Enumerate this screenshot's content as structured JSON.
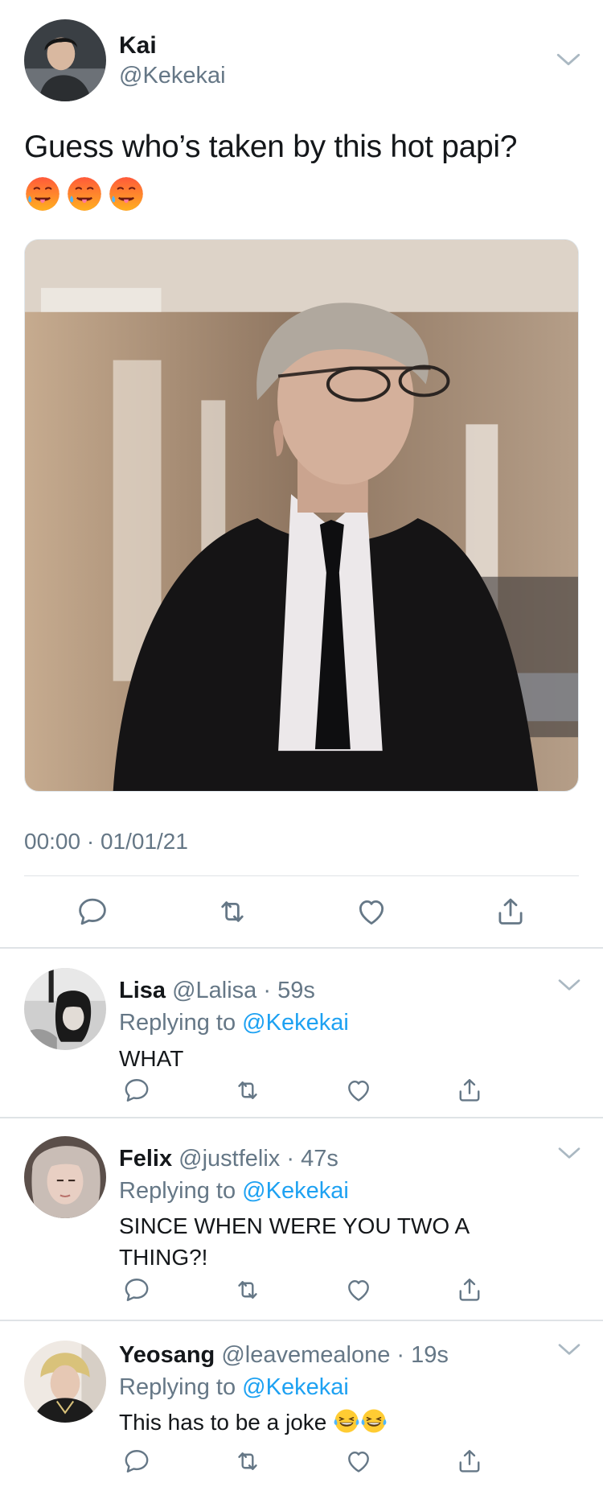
{
  "main_tweet": {
    "author_name": "Kai",
    "author_handle": "@Kekekai",
    "text": "Guess who’s taken by this hot papi?",
    "emojis": [
      "hot-face-emoji",
      "hot-face-emoji",
      "hot-face-emoji"
    ],
    "timestamp": "00:00 · 01/01/21",
    "actions": [
      "reply-icon",
      "retweet-icon",
      "like-icon",
      "share-icon"
    ]
  },
  "replies": [
    {
      "name": "Lisa",
      "handle": "@Lalisa",
      "time": "59s",
      "replying_prefix": "Replying to",
      "replying_to": "@Kekekai",
      "text": "WHAT"
    },
    {
      "name": "Felix",
      "handle": "@justfelix",
      "time": "47s",
      "replying_prefix": "Replying to",
      "replying_to": "@Kekekai",
      "text": "SINCE WHEN WERE YOU TWO A THING?!"
    },
    {
      "name": "Yeosang",
      "handle": "@leavemealone",
      "time": "19s",
      "replying_prefix": "Replying to",
      "replying_to": "@Kekekai",
      "text": "This has to be a joke",
      "emojis": [
        "tears-of-joy-emoji",
        "tears-of-joy-emoji"
      ]
    }
  ],
  "colors": {
    "text": "#14171a",
    "secondary": "#657786",
    "link": "#1da1f2",
    "divider": "#dfe3e6"
  }
}
